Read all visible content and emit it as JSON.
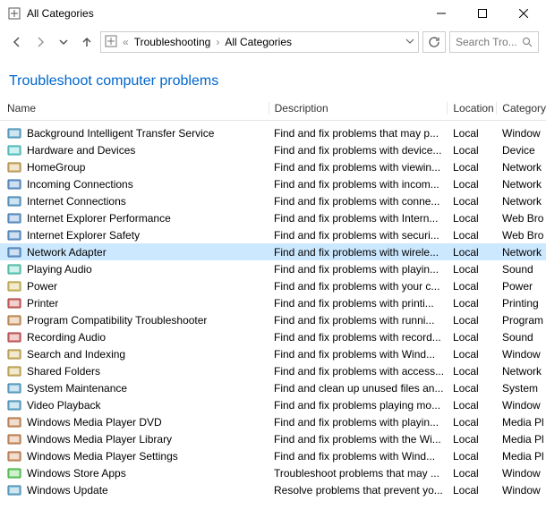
{
  "window": {
    "title": "All Categories"
  },
  "breadcrumb": {
    "part1": "Troubleshooting",
    "part2": "All Categories"
  },
  "search": {
    "placeholder": "Search Tro..."
  },
  "heading": "Troubleshoot computer problems",
  "columns": {
    "name": "Name",
    "description": "Description",
    "location": "Location",
    "category": "Category"
  },
  "items": [
    {
      "name": "Background Intelligent Transfer Service",
      "desc": "Find and fix problems that may p...",
      "loc": "Local",
      "cat": "Window",
      "selected": false,
      "hue": 200
    },
    {
      "name": "Hardware and Devices",
      "desc": "Find and fix problems with device...",
      "loc": "Local",
      "cat": "Device",
      "selected": false,
      "hue": 180
    },
    {
      "name": "HomeGroup",
      "desc": "Find and fix problems with viewin...",
      "loc": "Local",
      "cat": "Network",
      "selected": false,
      "hue": 40
    },
    {
      "name": "Incoming Connections",
      "desc": "Find and fix problems with incom...",
      "loc": "Local",
      "cat": "Network",
      "selected": false,
      "hue": 210
    },
    {
      "name": "Internet Connections",
      "desc": "Find and fix problems with conne...",
      "loc": "Local",
      "cat": "Network",
      "selected": false,
      "hue": 205
    },
    {
      "name": "Internet Explorer Performance",
      "desc": "Find and fix problems with Intern...",
      "loc": "Local",
      "cat": "Web Bro",
      "selected": false,
      "hue": 210
    },
    {
      "name": "Internet Explorer Safety",
      "desc": "Find and fix problems with securi...",
      "loc": "Local",
      "cat": "Web Bro",
      "selected": false,
      "hue": 210
    },
    {
      "name": "Network Adapter",
      "desc": "Find and fix problems with wirele...",
      "loc": "Local",
      "cat": "Network",
      "selected": true,
      "hue": 210
    },
    {
      "name": "Playing Audio",
      "desc": "Find and fix problems with playin...",
      "loc": "Local",
      "cat": "Sound",
      "selected": false,
      "hue": 170
    },
    {
      "name": "Power",
      "desc": "Find and fix problems with your c...",
      "loc": "Local",
      "cat": "Power",
      "selected": false,
      "hue": 50
    },
    {
      "name": "Printer",
      "desc": "Find and fix problems with printi...",
      "loc": "Local",
      "cat": "Printing",
      "selected": false,
      "hue": 0
    },
    {
      "name": "Program Compatibility Troubleshooter",
      "desc": "Find and fix problems with runni...",
      "loc": "Local",
      "cat": "Program",
      "selected": false,
      "hue": 30
    },
    {
      "name": "Recording Audio",
      "desc": "Find and fix problems with record...",
      "loc": "Local",
      "cat": "Sound",
      "selected": false,
      "hue": 0
    },
    {
      "name": "Search and Indexing",
      "desc": "Find and fix problems with Wind...",
      "loc": "Local",
      "cat": "Window",
      "selected": false,
      "hue": 45
    },
    {
      "name": "Shared Folders",
      "desc": "Find and fix problems with access...",
      "loc": "Local",
      "cat": "Network",
      "selected": false,
      "hue": 45
    },
    {
      "name": "System Maintenance",
      "desc": "Find and clean up unused files an...",
      "loc": "Local",
      "cat": "System",
      "selected": false,
      "hue": 200
    },
    {
      "name": "Video Playback",
      "desc": "Find and fix problems playing mo...",
      "loc": "Local",
      "cat": "Window",
      "selected": false,
      "hue": 200
    },
    {
      "name": "Windows Media Player DVD",
      "desc": "Find and fix problems with playin...",
      "loc": "Local",
      "cat": "Media Pl",
      "selected": false,
      "hue": 25
    },
    {
      "name": "Windows Media Player Library",
      "desc": "Find and fix problems with the Wi...",
      "loc": "Local",
      "cat": "Media Pl",
      "selected": false,
      "hue": 25
    },
    {
      "name": "Windows Media Player Settings",
      "desc": "Find and fix problems with Wind...",
      "loc": "Local",
      "cat": "Media Pl",
      "selected": false,
      "hue": 25
    },
    {
      "name": "Windows Store Apps",
      "desc": "Troubleshoot problems that may ...",
      "loc": "Local",
      "cat": "Window",
      "selected": false,
      "hue": 120
    },
    {
      "name": "Windows Update",
      "desc": "Resolve problems that prevent yo...",
      "loc": "Local",
      "cat": "Window",
      "selected": false,
      "hue": 200
    }
  ]
}
